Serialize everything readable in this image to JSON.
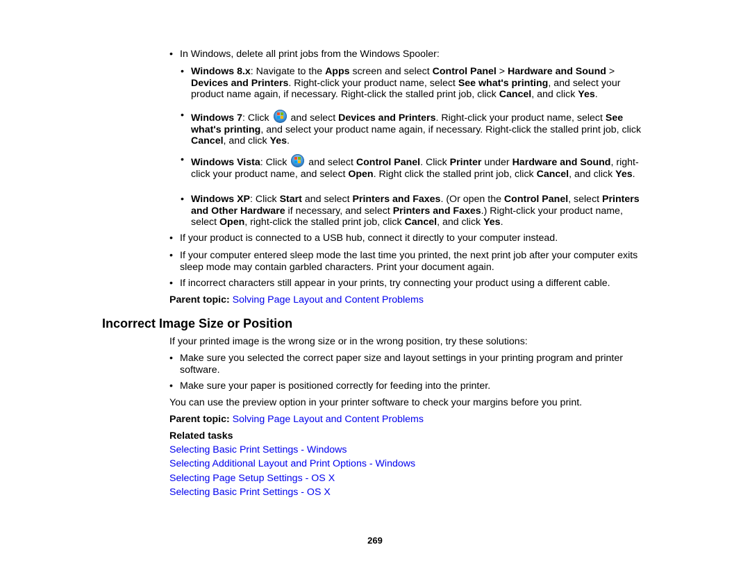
{
  "document": {
    "page_number": "269",
    "bullet_glyph": "•",
    "spooler_intro": "In Windows, delete all print jobs from the Windows Spooler:",
    "win8": {
      "label": "Windows 8.x",
      "t1": ": Navigate to the ",
      "apps": "Apps",
      "t2": " screen and select ",
      "control_panel": "Control Panel",
      "t3": " > ",
      "hardware_sound": "Hardware and Sound",
      "t4": " > ",
      "devices_printers": "Devices and Printers",
      "t5": ". Right-click your product name, select ",
      "see_whats": "See what's printing",
      "t6": ", and select your product name again, if necessary. Right-click the stalled print job, click ",
      "cancel": "Cancel",
      "t7": ", and click ",
      "yes": "Yes",
      "t8": "."
    },
    "win7": {
      "label": "Windows 7",
      "t1": ": Click ",
      "icon": "windows-start-orb-icon",
      "t2": " and select ",
      "devices_printers": "Devices and Printers",
      "t3": ". Right-click your product name, select ",
      "see_whats": "See what's printing",
      "t4": ", and select your product name again, if necessary. Right-click the stalled print job, click ",
      "cancel": "Cancel",
      "t5": ", and click ",
      "yes": "Yes",
      "t6": "."
    },
    "vista": {
      "label": "Windows Vista",
      "t1": ": Click ",
      "icon": "windows-start-orb-icon",
      "t2": " and select ",
      "control_panel": "Control Panel",
      "t3": ". Click ",
      "printer": "Printer",
      "t4": " under ",
      "hardware_sound": "Hardware and Sound",
      "t5": ", right-click your product name, and select ",
      "open": "Open",
      "t6": ". Right click the stalled print job, click ",
      "cancel": "Cancel",
      "t7": ", and click ",
      "yes": "Yes",
      "t8": "."
    },
    "xp": {
      "label": "Windows XP",
      "t1": ": Click ",
      "start": "Start",
      "t2": " and select ",
      "printers_faxes": "Printers and Faxes",
      "t3": ". (Or open the ",
      "control_panel": "Control Panel",
      "t4": ", select ",
      "printers_other": "Printers and Other Hardware",
      "t5": " if necessary, and select ",
      "printers_faxes2": "Printers and Faxes",
      "t6": ".) Right-click your product name, select ",
      "open": "Open",
      "t7": ", right-click the stalled print job, click ",
      "cancel": "Cancel",
      "t8": ", and click ",
      "yes": "Yes",
      "t9": "."
    },
    "usb_hub": "If your product is connected to a USB hub, connect it directly to your computer instead.",
    "sleep_mode": "If your computer entered sleep mode the last time you printed, the next print job after your computer exits sleep mode may contain garbled characters. Print your document again.",
    "cable": "If incorrect characters still appear in your prints, try connecting your product using a different cable.",
    "parent_topic_label": "Parent topic:",
    "parent_topic_link": "Solving Page Layout and Content Problems",
    "section2": {
      "title": "Incorrect Image Size or Position",
      "intro": "If your printed image is the wrong size or in the wrong position, try these solutions:",
      "bullets": [
        "Make sure you selected the correct paper size and layout settings in your printing program and printer software.",
        "Make sure your paper is positioned correctly for feeding into the printer."
      ],
      "preview_note": "You can use the preview option in your printer software to check your margins before you print.",
      "parent_topic_label": "Parent topic:",
      "parent_topic_link": "Solving Page Layout and Content Problems",
      "related_tasks_label": "Related tasks",
      "related_tasks": [
        "Selecting Basic Print Settings - Windows",
        "Selecting Additional Layout and Print Options - Windows",
        "Selecting Page Setup Settings - OS X",
        "Selecting Basic Print Settings - OS X"
      ]
    },
    "colors": {
      "link": "#0000ee",
      "text": "#000000"
    }
  }
}
